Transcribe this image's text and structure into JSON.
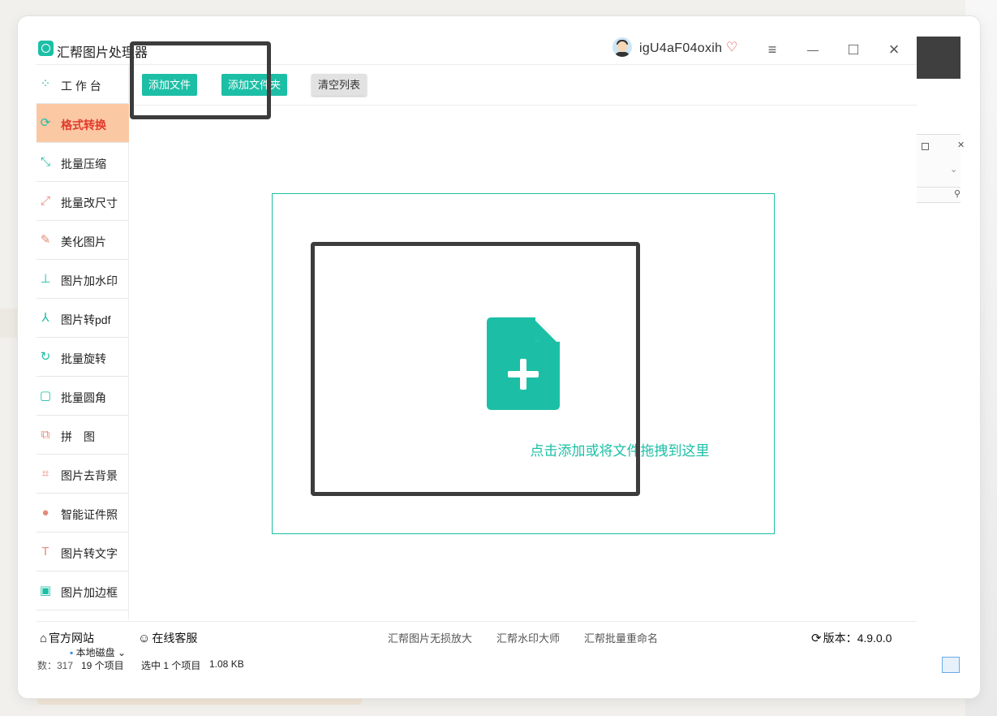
{
  "app": {
    "title": "汇帮图片处理器",
    "username": "igU4aF04oxih"
  },
  "window_controls": {
    "menu": "≡",
    "minimize": "—",
    "maximize": "□",
    "close": "×"
  },
  "sidebar": {
    "items": [
      {
        "label": "工 作 台",
        "icon": "grid-icon",
        "glyph": "⁘",
        "color": "#1cbfa6"
      },
      {
        "label": "格式转换",
        "icon": "convert-icon",
        "glyph": "⟳",
        "color": "#1cbfa6",
        "active": true
      },
      {
        "label": "批量压缩",
        "icon": "compress-icon",
        "glyph": "⤡",
        "color": "#1cbfa6"
      },
      {
        "label": "批量改尺寸",
        "icon": "resize-icon",
        "glyph": "⤢",
        "color": "#e58b7a"
      },
      {
        "label": "美化图片",
        "icon": "beautify-icon",
        "glyph": "✎",
        "color": "#e58b7a"
      },
      {
        "label": "图片加水印",
        "icon": "stamp-icon",
        "glyph": "⊥",
        "color": "#1cbfa6"
      },
      {
        "label": "图片转pdf",
        "icon": "pdf-icon",
        "glyph": "⅄",
        "color": "#1cbfa6"
      },
      {
        "label": "批量旋转",
        "icon": "rotate-icon",
        "glyph": "↻",
        "color": "#1cbfa6"
      },
      {
        "label": "批量圆角",
        "icon": "round-corner-icon",
        "glyph": "▢",
        "color": "#1cbfa6"
      },
      {
        "label": "拼　图",
        "icon": "puzzle-icon",
        "glyph": "⧉",
        "color": "#e58b7a"
      },
      {
        "label": "图片去背景",
        "icon": "crop-icon",
        "glyph": "⌗",
        "color": "#e58b7a"
      },
      {
        "label": "智能证件照",
        "icon": "person-icon",
        "glyph": "●",
        "color": "#e58b7a"
      },
      {
        "label": "图片转文字",
        "icon": "text-icon",
        "glyph": "T",
        "color": "#e58b7a"
      },
      {
        "label": "图片加边框",
        "icon": "frame-icon",
        "glyph": "▣",
        "color": "#1cbfa6"
      }
    ]
  },
  "toolbar": {
    "add_file": "添加文件",
    "add_folder": "添加文件夹",
    "clear_list": "清空列表"
  },
  "dropzone": {
    "text": "点击添加或将文件拖拽到这里"
  },
  "footer": {
    "website": "官方网站",
    "support": "在线客服",
    "products": [
      "汇帮图片无损放大",
      "汇帮水印大师",
      "汇帮批量重命名"
    ],
    "version": "版本：4.9.0.0"
  },
  "explorer_status": {
    "left_fragment": "数：317",
    "drive": "本地磁盘",
    "item_count": "19 个项目",
    "selected": "选中 1 个项目",
    "size": "1.08 KB"
  },
  "colors": {
    "accent": "#1cbfa6",
    "active_bg": "#fbc8a4",
    "active_text": "#e13a2b"
  }
}
